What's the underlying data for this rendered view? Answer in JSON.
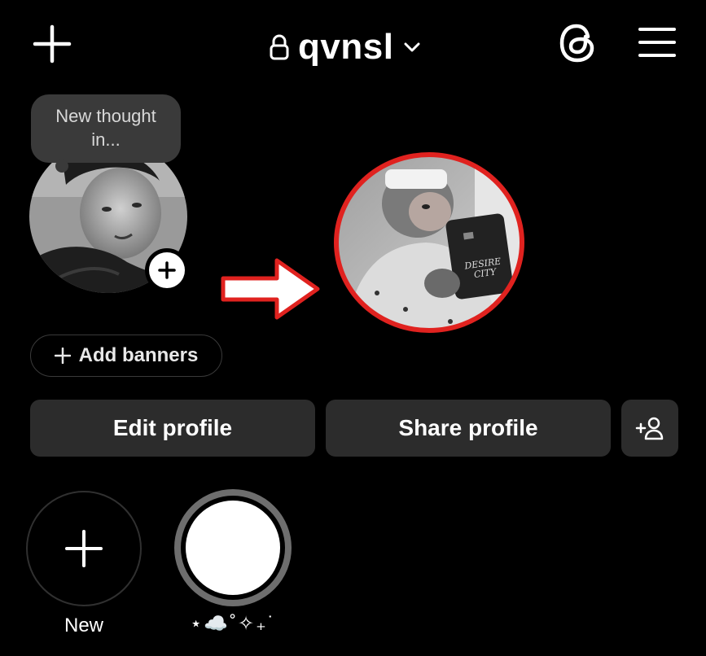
{
  "header": {
    "username": "qvnsl",
    "icons": [
      "plus-icon",
      "lock-icon",
      "chevron-down-icon",
      "threads-icon",
      "menu-icon"
    ]
  },
  "profile": {
    "thought_bubble_text": "New thought in...",
    "add_banners_label": "Add banners"
  },
  "actions": {
    "edit_profile_label": "Edit profile",
    "share_profile_label": "Share profile"
  },
  "highlights": [
    {
      "label": "New"
    },
    {
      "label": "⋆☁️˚✧₊˙"
    }
  ],
  "annotation": {
    "color": "#e0221f"
  }
}
